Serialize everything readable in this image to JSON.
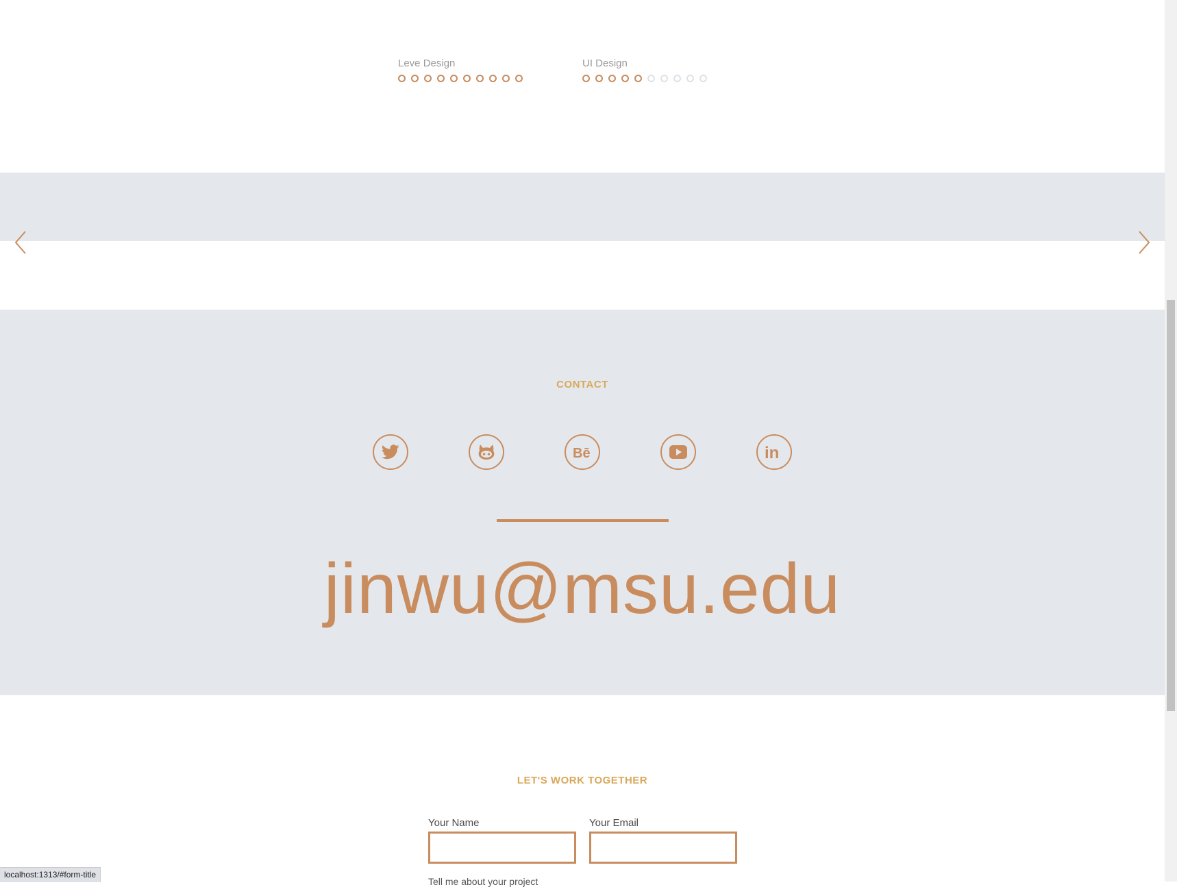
{
  "colors": {
    "accent": "#c98c5e",
    "title": "#d9a85a",
    "band": "#e4e8ec",
    "empty_dot": "#dde2e7"
  },
  "skills": [
    {
      "label": "Leve Design",
      "level": 10,
      "max": 10
    },
    {
      "label": "UI Design",
      "level": 5,
      "max": 10
    }
  ],
  "slider": {
    "prev_icon": "chevron-left-icon",
    "next_icon": "chevron-right-icon"
  },
  "contact": {
    "title": "CONTACT",
    "social": [
      {
        "name": "twitter",
        "icon": "twitter-icon"
      },
      {
        "name": "github",
        "icon": "github-icon"
      },
      {
        "name": "behance",
        "icon": "behance-icon"
      },
      {
        "name": "youtube",
        "icon": "youtube-icon"
      },
      {
        "name": "linkedin",
        "icon": "linkedin-icon"
      }
    ],
    "email": "jinwu@msu.edu"
  },
  "form": {
    "title": "LET'S WORK TOGETHER",
    "name_label": "Your Name",
    "name_value": "",
    "email_label": "Your Email",
    "email_value": "",
    "message_label_partial": "Tell me about your project"
  },
  "status_bar": {
    "url": "localhost:1313/#form-title"
  }
}
